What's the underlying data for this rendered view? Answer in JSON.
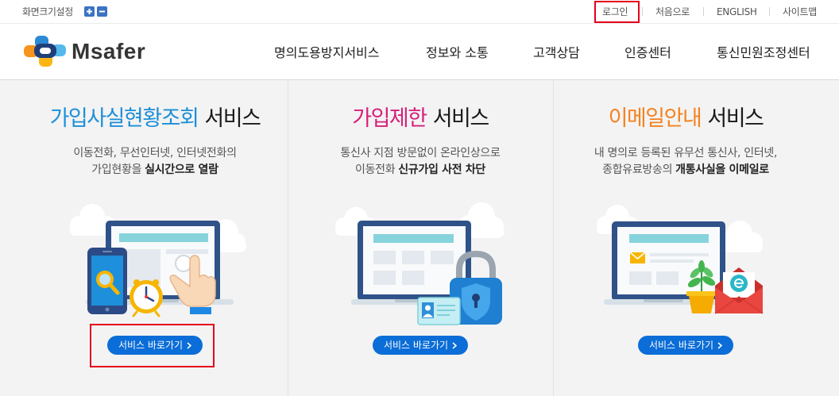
{
  "utility_bar": {
    "font_size_label": "화면크기설정",
    "zoom_in_icon": "plus-icon",
    "zoom_out_icon": "minus-icon",
    "links": [
      {
        "label": "로그인"
      },
      {
        "label": "처음으로"
      },
      {
        "label": "ENGLISH"
      },
      {
        "label": "사이트맵"
      }
    ]
  },
  "header": {
    "logo_text": "Msafer",
    "logo_icon": "msafer-logo-icon",
    "nav": [
      {
        "label": "명의도용방지서비스"
      },
      {
        "label": "정보와 소통"
      },
      {
        "label": "고객상담"
      },
      {
        "label": "인증센터"
      },
      {
        "label": "통신민원조정센터"
      }
    ]
  },
  "services": [
    {
      "title_highlight": "가입사실현황조회",
      "title_rest": "서비스",
      "accent_color": "#1d8fd8",
      "desc_line1": "이동전화, 무선인터넷, 인터넷전화의",
      "desc_line2": "가입현황을",
      "desc_line2_bold": "실시간으로 열람",
      "button_label": "서비스 바로가기",
      "button_icon": "chevron-right-icon",
      "icons": [
        "monitor-icon",
        "smartphone-icon",
        "magnifier-icon",
        "clock-icon",
        "pointing-hand-icon"
      ]
    },
    {
      "title_highlight": "가입제한",
      "title_rest": "서비스",
      "accent_color": "#d6207b",
      "desc_line1": "통신사 지점 방문없이 온라인상으로",
      "desc_line2": "이동전화",
      "desc_line2_bold": "신규가입 사전 차단",
      "button_label": "서비스 바로가기",
      "button_icon": "chevron-right-icon",
      "icons": [
        "monitor-icon",
        "padlock-icon",
        "id-card-icon"
      ]
    },
    {
      "title_highlight": "이메일안내",
      "title_rest": "서비스",
      "accent_color": "#f5821f",
      "desc_line1": "내 명의로 등록된 유무선 통신사, 인터넷,",
      "desc_line2": "종합유료방송의",
      "desc_line2_bold": "개통사실을 이메일로",
      "button_label": "서비스 바로가기",
      "button_icon": "chevron-right-icon",
      "icons": [
        "monitor-icon",
        "mail-icon",
        "plant-icon",
        "email-envelope-icon"
      ]
    }
  ],
  "colors": {
    "button": "#0b6dd7",
    "highlight_box": "#e3001b",
    "text": "#222222",
    "muted_text": "#555555",
    "page_background": "#f3f3f3"
  }
}
